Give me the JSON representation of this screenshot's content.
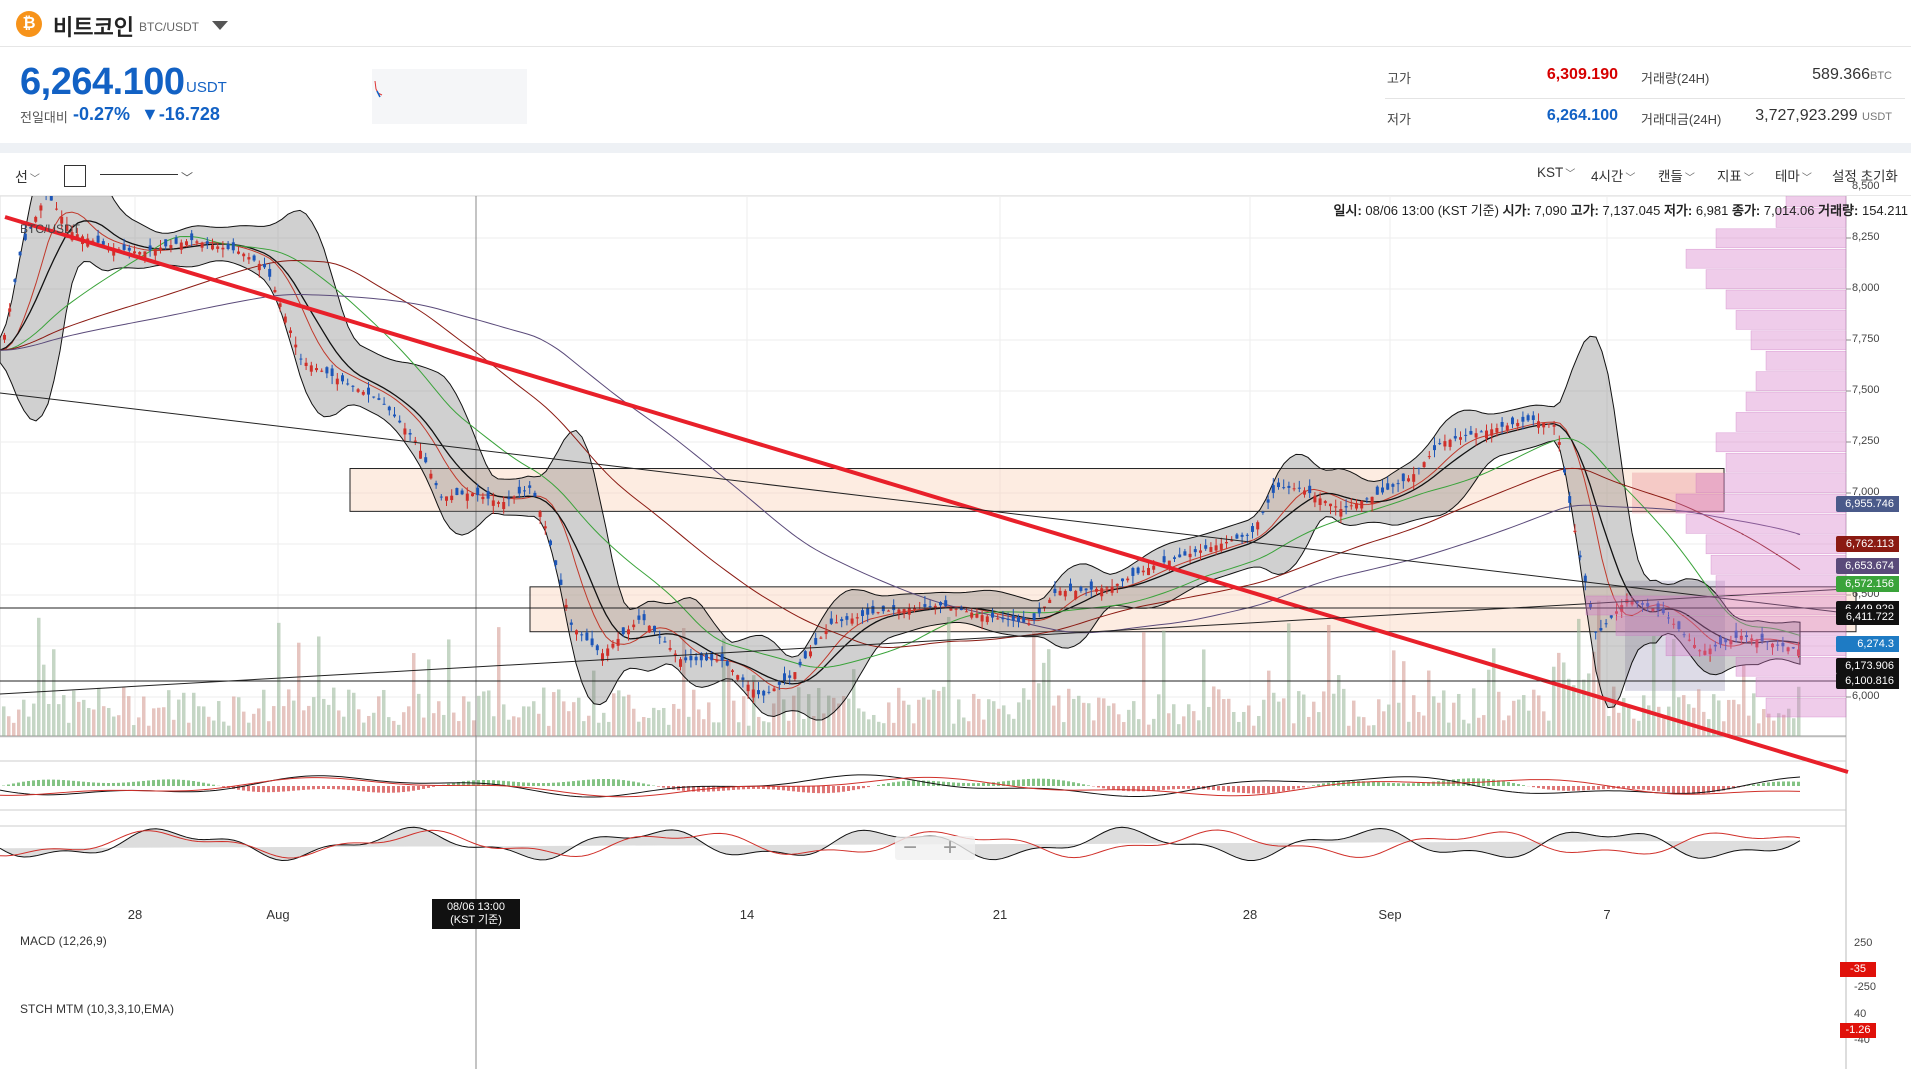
{
  "header": {
    "coin_icon": "bitcoin-icon",
    "coin_symbol_glyph": "₿",
    "coin_name": "비트코인",
    "pair": "BTC/USDT"
  },
  "price": {
    "current": "6,264.100",
    "unit": "USDT",
    "change_label": "전일대비",
    "change_pct": "-0.27%",
    "change_amt": "▼-16.728",
    "color": "#1261c4"
  },
  "stats": {
    "high_label": "고가",
    "high_value": "6,309.190",
    "low_label": "저가",
    "low_value": "6,264.100",
    "vol_label": "거래량(24H)",
    "vol_value": "589.366",
    "vol_unit": "BTC",
    "amt_label": "거래대금(24H)",
    "amt_value": "3,727,923.299",
    "amt_unit": "USDT",
    "up_color": "#d60000",
    "down_color": "#1261c4"
  },
  "toolbar": {
    "line_tool": "선",
    "timezone": "KST",
    "interval": "4시간",
    "chart_type": "캔들",
    "indicators": "지표",
    "theme": "테마",
    "reset": "설정 초기화"
  },
  "ohlc": {
    "date_label": "일시:",
    "date_value": "08/06 13:00 (KST 기준)",
    "open_label": "시가:",
    "open_value": "7,090",
    "high_label": "고가:",
    "high_value": "7,137.045",
    "low_label": "저가:",
    "low_value": "6,981",
    "close_label": "종가:",
    "close_value": "7,014.06",
    "volume_label": "거래량:",
    "volume_value": "154.211"
  },
  "chart_data": {
    "type": "candlestick",
    "series_label": "BTC/USDT",
    "y_ticks": [
      "8,500",
      "8,250",
      "8,000",
      "7,750",
      "7,500",
      "7,250",
      "7,000",
      "6,750",
      "6,500",
      "6,250",
      "6,000"
    ],
    "x_ticks": [
      "28",
      "Aug",
      "14",
      "21",
      "28",
      "Sep",
      "7"
    ],
    "crosshair_x_label": "08/06 13:00\n(KST 기준)",
    "price_tags": [
      {
        "value": "6,955.746",
        "color": "#4a5a8a"
      },
      {
        "value": "6,762.113",
        "color": "#8b1a12"
      },
      {
        "value": "6,653.674",
        "color": "#5a4a7a"
      },
      {
        "value": "6,572.156",
        "color": "#3aa33a"
      },
      {
        "value": "6,449.929",
        "color": "#111111"
      },
      {
        "value": "6,411.722",
        "color": "#111111"
      },
      {
        "value": "6,274.3",
        "color": "#1e7bc4"
      },
      {
        "value": "6,173.906",
        "color": "#111111"
      },
      {
        "value": "6,100.816",
        "color": "#111111"
      }
    ],
    "macd": {
      "label": "MACD (12,26,9)",
      "ticks": [
        "250",
        "-250"
      ],
      "last": "-35"
    },
    "stch": {
      "label": "STCH MTM (10,3,3,10,EMA)",
      "ticks": [
        "40",
        "-40"
      ],
      "last": "-1.26"
    }
  }
}
